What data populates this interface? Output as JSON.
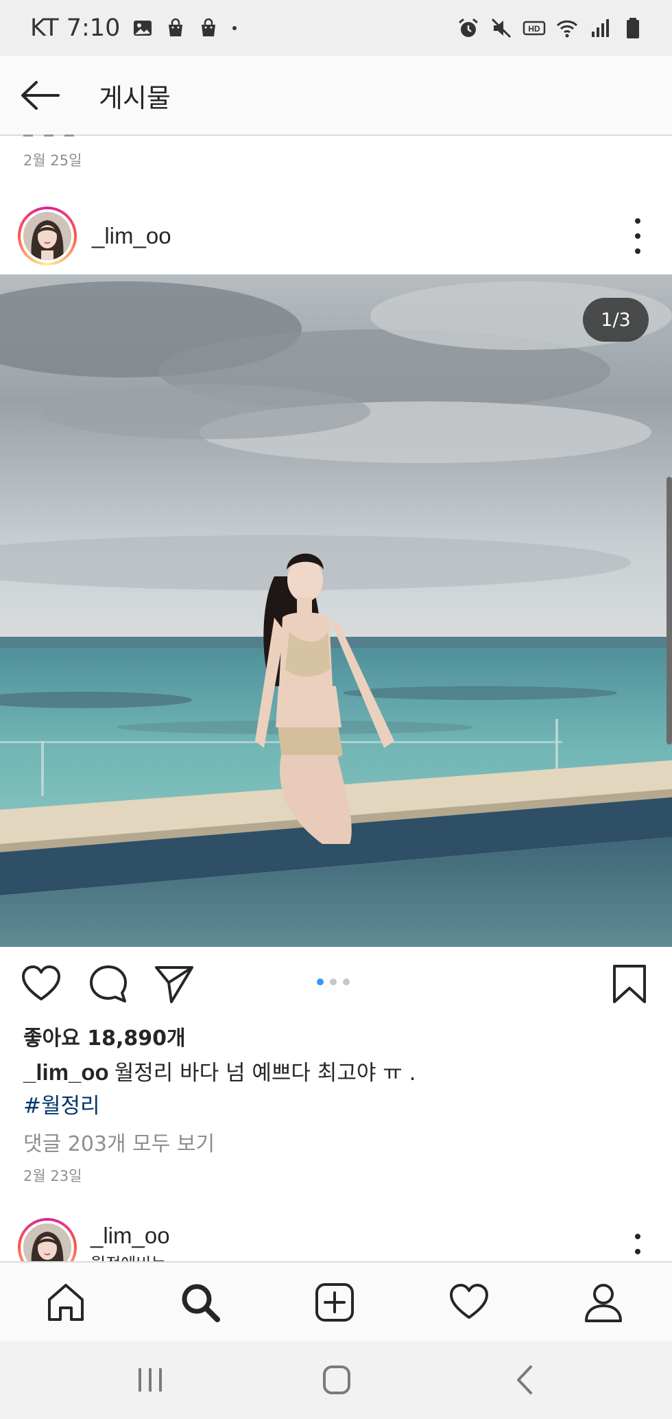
{
  "status_bar": {
    "carrier_time": "KT 7:10",
    "left_icons": [
      "gallery-icon",
      "shopping-bag-icon",
      "shopping-bag-icon",
      "dot-icon"
    ],
    "right_icons": [
      "alarm-icon",
      "mute-icon",
      "hd-icon",
      "wifi-icon",
      "signal-icon",
      "battery-icon"
    ]
  },
  "header": {
    "title": "게시물"
  },
  "previous_post": {
    "date": "2월 25일"
  },
  "post": {
    "username": "_lim_oo",
    "page_indicator": "1/3",
    "carousel_pages": 3,
    "carousel_active": 1,
    "likes": "좋아요 18,890개",
    "caption_user": "_lim_oo",
    "caption_text": "월정리 바다 넘 예쁘다 최고야 ㅠ .",
    "hashtag": "#월정리",
    "view_comments": "댓글 203개 모두 보기",
    "date": "2월 23일"
  },
  "next_post": {
    "username": "_lim_oo",
    "subtitle": "월정에비는"
  },
  "bottom_nav": {
    "items": [
      "home-icon",
      "search-icon",
      "new-post-icon",
      "activity-heart-icon",
      "profile-icon"
    ],
    "active": "search-icon"
  },
  "colors": {
    "hashtag": "#003569",
    "carousel_active_dot": "#3897f0",
    "muted_text": "#8e8e8e"
  }
}
